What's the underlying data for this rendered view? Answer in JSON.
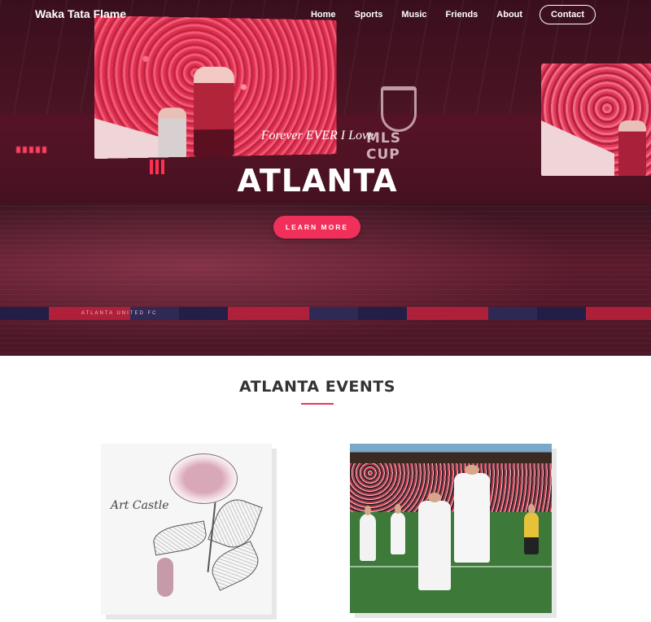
{
  "nav": {
    "brand": "Waka Tata Flame",
    "links": [
      "Home",
      "Sports",
      "Music",
      "Friends",
      "About"
    ],
    "contact": "Contact"
  },
  "hero": {
    "tagline": "Forever EVER I Love",
    "title": "ATLANTA",
    "cta": "LEARN MORE",
    "screen_logo": "MLS CUP",
    "ad_band": "ATLANTA UNITED FC"
  },
  "events": {
    "title": "ATLANTA EVENTS",
    "cards": [
      {
        "art_text": "Art Castle"
      },
      {
        "type": "soccer-photo"
      }
    ]
  },
  "colors": {
    "accent": "#f0305a",
    "hero_tint": "#8a1a3a",
    "heading": "#333333"
  }
}
